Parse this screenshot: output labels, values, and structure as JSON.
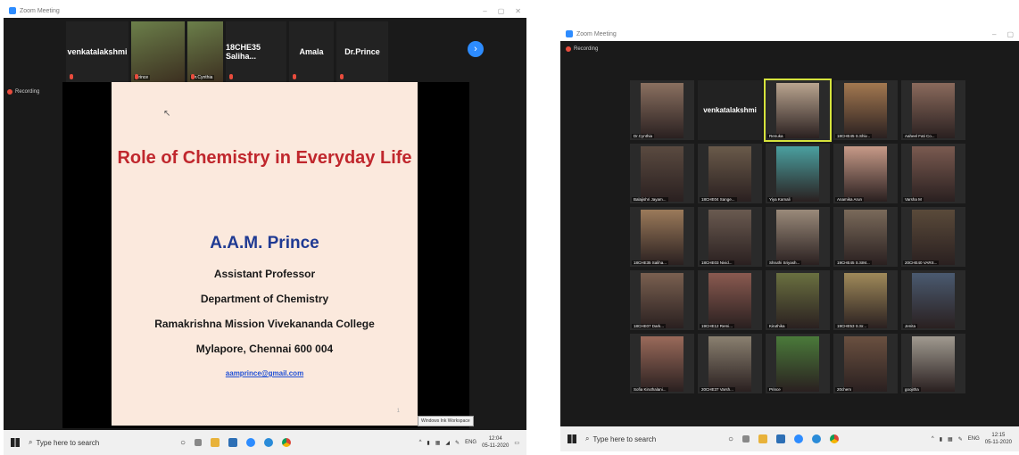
{
  "left": {
    "window_title": "Zoom Meeting",
    "recording_label": "Recording",
    "strip": [
      {
        "label": "venkatalakshmi",
        "type": "name"
      },
      {
        "label": "Prince",
        "type": "video"
      },
      {
        "label": "Dr.Cynthia",
        "type": "video"
      },
      {
        "label": "18CHE35 Saliha...",
        "type": "name"
      },
      {
        "label": "Amala",
        "type": "name"
      },
      {
        "label": "Dr.Prince",
        "type": "name"
      }
    ],
    "slide": {
      "title": "Role of Chemistry in Everyday Life",
      "name": "A.A.M. Prince",
      "role": "Assistant Professor",
      "department": "Department of Chemistry",
      "college": "Ramakrishna Mission Vivekananda College",
      "address": "Mylapore, Chennai 600 004",
      "email": "aamprince@gmail.com",
      "page": "1"
    },
    "ink_tooltip": "Windows Ink Workspace",
    "taskbar": {
      "search_placeholder": "Type here to search",
      "lang": "ENG",
      "time": "12:04",
      "date": "05-11-2020"
    }
  },
  "right": {
    "window_title": "Zoom Meeting",
    "recording_label": "Recording",
    "tiles": [
      {
        "label": "Dr.Cynthia",
        "bg": "#8a7060"
      },
      {
        "label": "venkatalakshmi",
        "bg": "#222222",
        "name": true
      },
      {
        "label": "Renuka",
        "bg": "#b9a48f",
        "active": true
      },
      {
        "label": "18CHE45 S.Shiv...",
        "bg": "#a37850"
      },
      {
        "label": "Aaheel Fati Co...",
        "bg": "#8a6a5c"
      },
      {
        "label": "Balajishri Jayam...",
        "bg": "#5a4a40"
      },
      {
        "label": "18CHE04 Sange...",
        "bg": "#6a5a4a"
      },
      {
        "label": "Yiya Kamali",
        "bg": "#4aa0a0"
      },
      {
        "label": "Anamika Arun",
        "bg": "#c79a88"
      },
      {
        "label": "Varsha M",
        "bg": "#7a5a50"
      },
      {
        "label": "18CHE35 Saliha...",
        "bg": "#9b7a5a"
      },
      {
        "label": "18CHE03 Nivid...",
        "bg": "#6a5a50"
      },
      {
        "label": "Shruthi Sriyash...",
        "bg": "#9a8a7a"
      },
      {
        "label": "19CHE45 S.SIM...",
        "bg": "#7a6a5a"
      },
      {
        "label": "20CHE40 VARS...",
        "bg": "#5a4a3a"
      },
      {
        "label": "18CHE07 Dark...",
        "bg": "#7a6050"
      },
      {
        "label": "19CHE12 Remi...",
        "bg": "#8a5a50"
      },
      {
        "label": "Kiruthika",
        "bg": "#6a7040"
      },
      {
        "label": "19CHE53 S.Sr...",
        "bg": "#a08a5a"
      },
      {
        "label": "Jenita",
        "bg": "#4a5a70"
      },
      {
        "label": "Sofia Kiruthalani...",
        "bg": "#9a6a5a"
      },
      {
        "label": "20CHE37 Varsh...",
        "bg": "#8a8070"
      },
      {
        "label": "Prince",
        "bg": "#4a7a3a"
      },
      {
        "label": "20chem",
        "bg": "#6a5040"
      },
      {
        "label": "goojitha",
        "bg": "#a09a90"
      }
    ],
    "taskbar": {
      "search_placeholder": "Type here to search",
      "lang": "ENG",
      "time": "12:15",
      "date": "05-11-2020"
    }
  }
}
